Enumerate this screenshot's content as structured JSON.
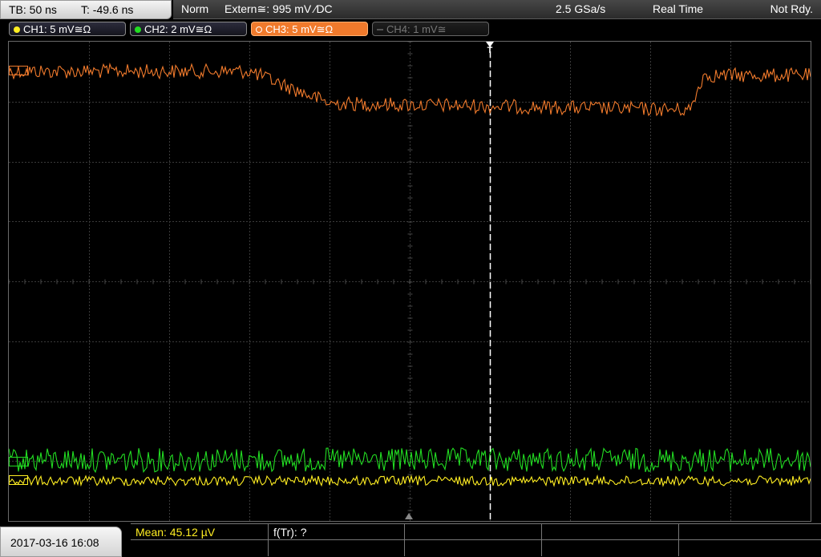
{
  "topbar": {
    "timebase": "TB: 50 ns",
    "trigger_offset": "T: -49.6 ns"
  },
  "status": {
    "mode": "Norm",
    "trigger": "Extern≅: 995 mV ⁄DC",
    "sample_rate": "2.5 GSa/s",
    "acquisition": "Real Time",
    "state": "Not Rdy."
  },
  "channels": [
    {
      "id": "CH1",
      "label": "CH1: 5 mV≅Ω",
      "color": "#ffee22",
      "active": false,
      "enabled": true
    },
    {
      "id": "CH2",
      "label": "CH2: 2 mV≅Ω",
      "color": "#22dd22",
      "active": false,
      "enabled": true
    },
    {
      "id": "CH3",
      "label": "CH3: 5 mV≅Ω",
      "color": "#f07a2c",
      "active": true,
      "enabled": true
    },
    {
      "id": "CH4",
      "label": "CH4: 1 mV≅",
      "color": "#777777",
      "active": false,
      "enabled": false
    }
  ],
  "markers": {
    "trigger_symbol": "T"
  },
  "waveforms": {
    "ch3_color": "#f07a2c",
    "ch2_color": "#22dd22",
    "ch1_color": "#ffee22"
  },
  "bottom": {
    "datetime": "2017-03-16 16:08",
    "mean": "Mean: 45.12 µV",
    "f_tr": "f(Tr): ?"
  }
}
